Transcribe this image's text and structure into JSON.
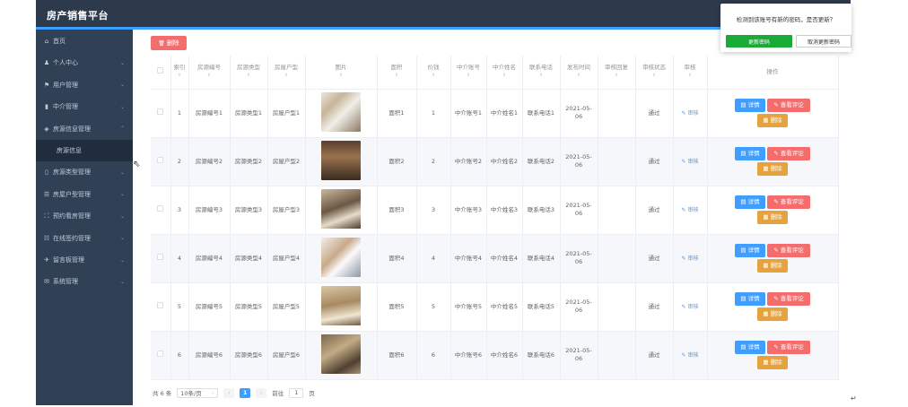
{
  "brand": "房产销售平台",
  "sidebar": {
    "items": [
      {
        "icon": "⌂",
        "label": "首页",
        "chevron": ""
      },
      {
        "icon": "♟",
        "label": "个人中心",
        "chevron": "⌄"
      },
      {
        "icon": "⚑",
        "label": "用户管理",
        "chevron": "⌄"
      },
      {
        "icon": "▮",
        "label": "中介管理",
        "chevron": "⌄"
      },
      {
        "icon": "◈",
        "label": "房源信息管理",
        "chevron": "⌃"
      },
      {
        "icon": "",
        "label": "房源信息",
        "chevron": ""
      },
      {
        "icon": "▯",
        "label": "房源类型管理",
        "chevron": "⌄"
      },
      {
        "icon": "☰",
        "label": "房屋户型管理",
        "chevron": "⌄"
      },
      {
        "icon": "⛶",
        "label": "预约看房管理",
        "chevron": "⌄"
      },
      {
        "icon": "☷",
        "label": "在线签约管理",
        "chevron": "⌄"
      },
      {
        "icon": "✈",
        "label": "留言板管理",
        "chevron": "⌄"
      },
      {
        "icon": "✉",
        "label": "系统管理",
        "chevron": "⌄"
      }
    ]
  },
  "toolbar": {
    "delete_label": "删除",
    "delete_icon": "🗑"
  },
  "table": {
    "headers": [
      "",
      "索引",
      "房源编号",
      "房源类型",
      "房屋户型",
      "图片",
      "面积",
      "价钱",
      "中介账号",
      "中介姓名",
      "联系电话",
      "发布时间",
      "审核回复",
      "审核状态",
      "审核",
      "操作"
    ],
    "rows": [
      {
        "index": "1",
        "code": "房源编号1",
        "type": "房源类型1",
        "layout": "房屋户型1",
        "area": "面积1",
        "price": "1",
        "agent_account": "中介账号1",
        "agent_name": "中介姓名1",
        "phone": "联系电话1",
        "date": "2021-05-06",
        "reply": "",
        "status": "通过",
        "audit": "✎ 审核"
      },
      {
        "index": "2",
        "code": "房源编号2",
        "type": "房源类型2",
        "layout": "房屋户型2",
        "area": "面积2",
        "price": "2",
        "agent_account": "中介账号2",
        "agent_name": "中介姓名2",
        "phone": "联系电话2",
        "date": "2021-05-06",
        "reply": "",
        "status": "通过",
        "audit": "✎ 审核"
      },
      {
        "index": "3",
        "code": "房源编号3",
        "type": "房源类型3",
        "layout": "房屋户型3",
        "area": "面积3",
        "price": "3",
        "agent_account": "中介账号3",
        "agent_name": "中介姓名3",
        "phone": "联系电话3",
        "date": "2021-05-06",
        "reply": "",
        "status": "通过",
        "audit": "✎ 审核"
      },
      {
        "index": "4",
        "code": "房源编号4",
        "type": "房源类型4",
        "layout": "房屋户型4",
        "area": "面积4",
        "price": "4",
        "agent_account": "中介账号4",
        "agent_name": "中介姓名4",
        "phone": "联系电话4",
        "date": "2021-05-06",
        "reply": "",
        "status": "通过",
        "audit": "✎ 审核"
      },
      {
        "index": "5",
        "code": "房源编号5",
        "type": "房源类型5",
        "layout": "房屋户型5",
        "area": "面积5",
        "price": "5",
        "agent_account": "中介账号5",
        "agent_name": "中介姓名5",
        "phone": "联系电话5",
        "date": "2021-05-06",
        "reply": "",
        "status": "通过",
        "audit": "✎ 审核"
      },
      {
        "index": "6",
        "code": "房源编号6",
        "type": "房源类型6",
        "layout": "房屋户型6",
        "area": "面积6",
        "price": "6",
        "agent_account": "中介账号6",
        "agent_name": "中介姓名6",
        "phone": "联系电话6",
        "date": "2021-05-06",
        "reply": "",
        "status": "通过",
        "audit": "✎ 审核"
      }
    ],
    "actions": {
      "detail": "详情",
      "comments": "查看评论",
      "delete": "删除"
    }
  },
  "pager": {
    "total": "共 6 条",
    "size": "10条/页",
    "page": "1",
    "goto_prefix": "前往",
    "goto_value": "1",
    "goto_suffix": "页",
    "prev": "‹",
    "next": "›"
  },
  "popup": {
    "message": "检测到该账号有新的密码，是否更新？",
    "confirm": "更新密码",
    "cancel": "取消更新密码"
  },
  "colors": {
    "topbar": "#2d3a4b",
    "sidebar": "#304156",
    "primary": "#409eff",
    "danger": "#f56c6c",
    "warning": "#e6a23c"
  }
}
